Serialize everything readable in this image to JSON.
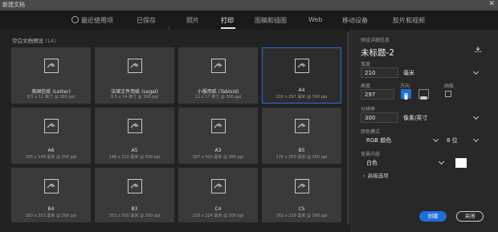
{
  "window": {
    "title": "新建文档",
    "close_glyph": "✕"
  },
  "tabs": [
    {
      "label": "最近使用项",
      "icon": "clock-icon"
    },
    {
      "label": "已保存"
    },
    {
      "label": "照片"
    },
    {
      "label": "打印",
      "active": true
    },
    {
      "label": "图稿和插图"
    },
    {
      "label": "Web"
    },
    {
      "label": "移动设备"
    },
    {
      "label": "胶片和视频"
    }
  ],
  "presets": {
    "section_title": "空白文档预设",
    "count": "(14)",
    "items": [
      {
        "name": "美国信纸 (Letter)",
        "size": "8.5 x 11 英寸 @ 300 ppi"
      },
      {
        "name": "法律文件用纸 (Legal)",
        "size": "8.5 x 14 英寸 @ 300 ppi"
      },
      {
        "name": "小报用纸 (Tabloid)",
        "size": "11 x 17 英寸 @ 300 ppi"
      },
      {
        "name": "A4",
        "size": "210 x 297 毫米 @ 300 ppi",
        "selected": true
      },
      {
        "name": "A6",
        "size": "105 x 148 毫米 @ 300 ppi"
      },
      {
        "name": "A5",
        "size": "148 x 210 毫米 @ 300 ppi"
      },
      {
        "name": "A3",
        "size": "297 x 420 毫米 @ 300 ppi"
      },
      {
        "name": "B5",
        "size": "176 x 250 毫米 @ 300 ppi"
      },
      {
        "name": "B4",
        "size": "250 x 353 毫米 @ 300 ppi"
      },
      {
        "name": "B3",
        "size": "353 x 500 毫米 @ 300 ppi"
      },
      {
        "name": "C4",
        "size": "229 x 324 毫米 @ 300 ppi"
      },
      {
        "name": "C5",
        "size": "162 x 229 毫米 @ 300 ppi"
      }
    ]
  },
  "details": {
    "header": "预设详细信息",
    "doc_title": "未标题-2",
    "width_label": "宽度",
    "width_value": "210",
    "width_unit": "毫米",
    "height_label": "高度",
    "height_value": "297",
    "orientation_label": "方向",
    "artboard_label": "画板",
    "resolution_label": "分辨率",
    "resolution_value": "300",
    "resolution_unit": "像素/英寸",
    "color_mode_label": "颜色模式",
    "color_mode_value": "RGB 颜色",
    "bit_depth_value": "8 位",
    "background_label": "背景内容",
    "background_value": "白色",
    "advanced_label": "高级选项",
    "advanced_glyph": "›"
  },
  "buttons": {
    "create": "创建",
    "close": "关闭"
  },
  "colors": {
    "accent": "#1e6fd9",
    "background": "#1e1e1e"
  }
}
